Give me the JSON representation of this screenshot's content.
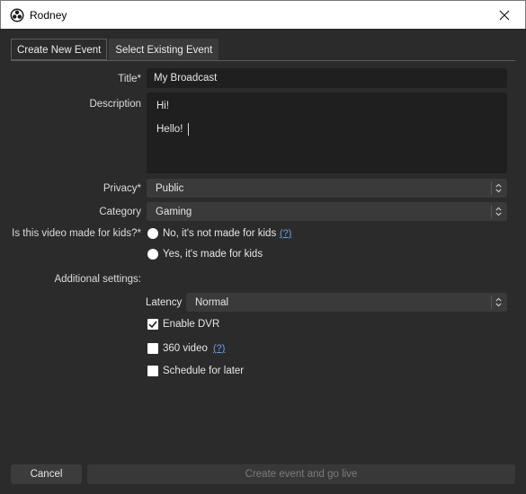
{
  "window": {
    "title": "Rodney",
    "app_icon": "obs-icon",
    "close_icon": "close-icon"
  },
  "tabs": [
    {
      "label": "Create New Event",
      "active": true
    },
    {
      "label": "Select Existing Event",
      "active": false
    }
  ],
  "form": {
    "title_label": "Title*",
    "title_value": "My Broadcast",
    "description_label": "Description",
    "description_lines": [
      "Hi!",
      "Hello!"
    ],
    "privacy_label": "Privacy*",
    "privacy_value": "Public",
    "category_label": "Category",
    "category_value": "Gaming",
    "kids_label": "Is this video made for kids?*",
    "kids_options": [
      {
        "label": "No, it's not made for kids",
        "selected": false,
        "help": "(?)"
      },
      {
        "label": "Yes, it's made for kids",
        "selected": false
      }
    ],
    "additional_label": "Additional settings:",
    "latency_label": "Latency",
    "latency_value": "Normal",
    "checkboxes": [
      {
        "label": "Enable DVR",
        "checked": true
      },
      {
        "label": "360 video",
        "checked": false,
        "help": "(?)"
      },
      {
        "label": "Schedule for later",
        "checked": false
      }
    ]
  },
  "buttons": {
    "cancel": "Cancel",
    "create": "Create event and go live"
  },
  "colors": {
    "background": "#2b2b2b",
    "input": "#1f1f1f",
    "combo": "#3a3a3a",
    "link": "#6b9ee6"
  }
}
